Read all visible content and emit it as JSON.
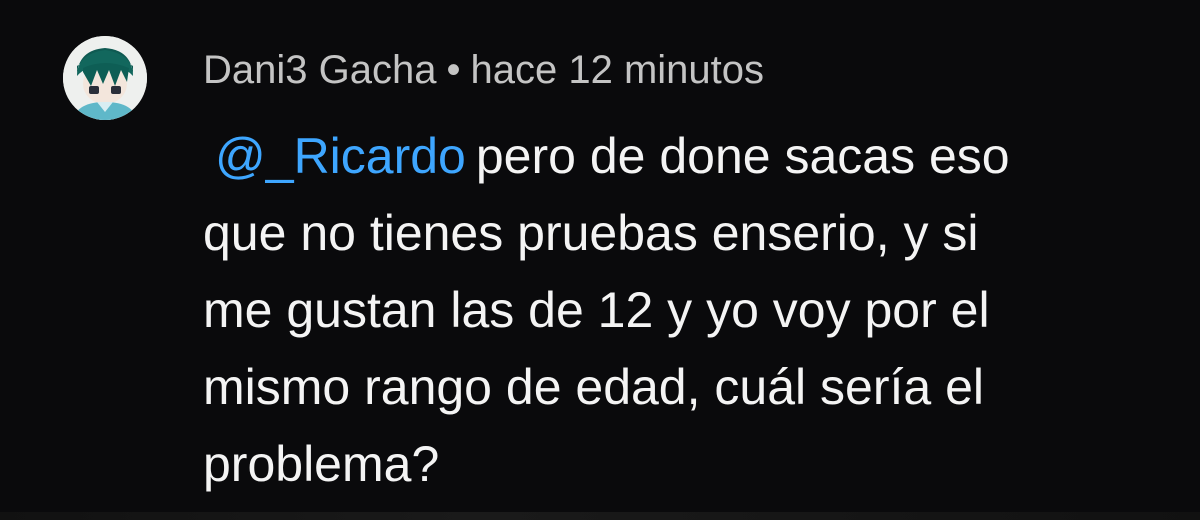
{
  "comment": {
    "author": "Dani3 Gacha",
    "separator": "•",
    "timestamp": "hace 12 minutos",
    "mention": "@_Ricardo",
    "lines": [
      "pero de done sacas eso",
      "que no tienes pruebas enserio, y si",
      "me gustan las de 12 y yo voy por el",
      "mismo rango de edad, cuál sería el",
      "problema?"
    ]
  },
  "colors": {
    "background": "#0a0a0c",
    "mention": "#3ea6ff",
    "meta_text": "#c4c4c4",
    "body_text": "#f4f4f4"
  },
  "icons": {
    "avatar": "user-avatar-icon"
  }
}
